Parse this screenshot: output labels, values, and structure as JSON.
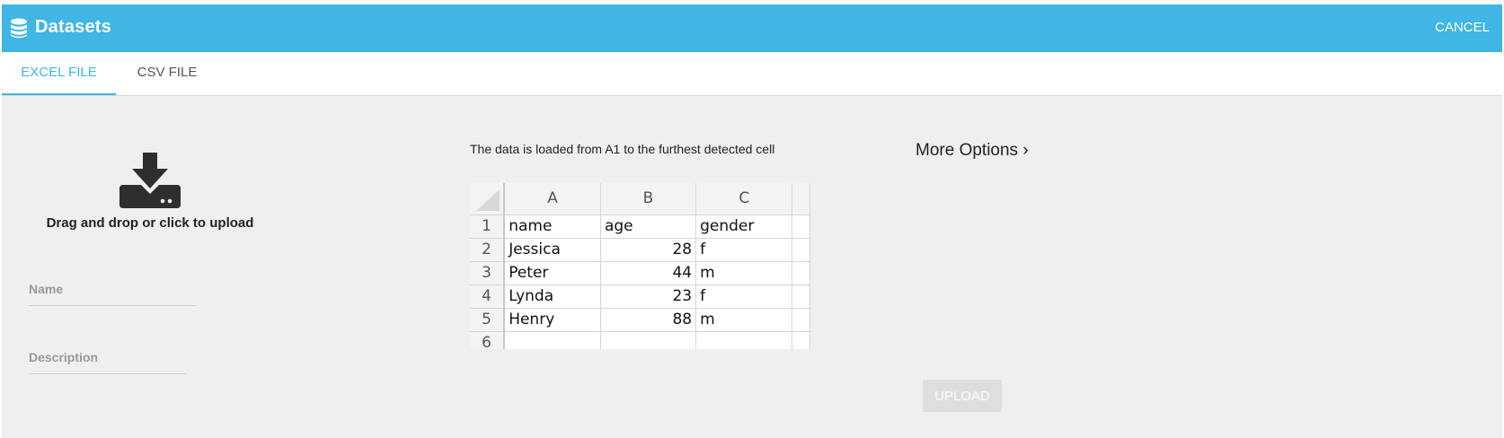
{
  "header": {
    "title": "Datasets",
    "cancel_label": "CANCEL",
    "icon": "database-icon",
    "color": "#3fb6e3"
  },
  "tabs": [
    {
      "label": "EXCEL FILE",
      "active": true
    },
    {
      "label": "CSV FILE",
      "active": false
    }
  ],
  "upload": {
    "icon": "download-tray-icon",
    "text": "Drag and drop or click to upload"
  },
  "form": {
    "name_label": "Name",
    "description_label": "Description"
  },
  "preview": {
    "info": "The data is loaded from A1 to the furthest detected cell",
    "columns": [
      "A",
      "B",
      "C"
    ],
    "rows": [
      {
        "index": "1",
        "cells": [
          "name",
          "age",
          "gender"
        ]
      },
      {
        "index": "2",
        "cells": [
          "Jessica",
          "28",
          "f"
        ]
      },
      {
        "index": "3",
        "cells": [
          "Peter",
          "44",
          "m"
        ]
      },
      {
        "index": "4",
        "cells": [
          "Lynda",
          "23",
          "f"
        ]
      },
      {
        "index": "5",
        "cells": [
          "Henry",
          "88",
          "m"
        ]
      },
      {
        "index": "6",
        "cells": [
          "",
          "",
          ""
        ]
      }
    ]
  },
  "options": {
    "more_options_label": "More Options",
    "chevron": "›",
    "upload_label": "UPLOAD"
  }
}
